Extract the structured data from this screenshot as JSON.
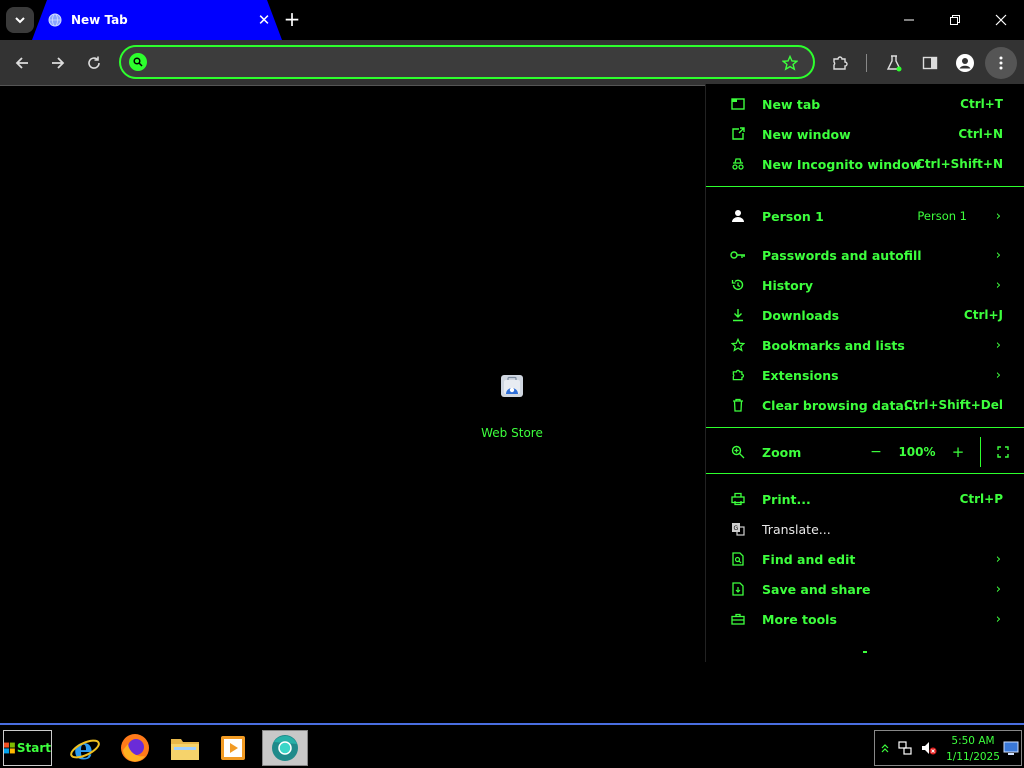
{
  "browser": {
    "tab": {
      "title": "New Tab",
      "close_glyph": "✕"
    },
    "new_tab_glyph": "+",
    "omnibox": {
      "value": "",
      "placeholder": ""
    }
  },
  "content": {
    "shortcuts": [
      {
        "label": "Web Store",
        "icon": "web-store-icon"
      }
    ]
  },
  "menu": {
    "group1": [
      {
        "label": "New tab",
        "shortcut": "Ctrl+T",
        "icon": "new-tab-icon"
      },
      {
        "label": "New window",
        "shortcut": "Ctrl+N",
        "icon": "new-window-icon"
      },
      {
        "label": "New Incognito window",
        "shortcut": "Ctrl+Shift+N",
        "icon": "incognito-icon"
      }
    ],
    "profile": {
      "label": "Person 1",
      "sub": "Person 1",
      "icon": "person-icon"
    },
    "group2": [
      {
        "label": "Passwords and autofill",
        "shortcut": "",
        "chevron": true,
        "icon": "key-icon"
      },
      {
        "label": "History",
        "shortcut": "",
        "chevron": true,
        "icon": "history-icon"
      },
      {
        "label": "Downloads",
        "shortcut": "Ctrl+J",
        "chevron": false,
        "icon": "download-icon"
      },
      {
        "label": "Bookmarks and lists",
        "shortcut": "",
        "chevron": true,
        "icon": "star-icon"
      },
      {
        "label": "Extensions",
        "shortcut": "",
        "chevron": true,
        "icon": "puzzle-icon"
      },
      {
        "label": "Clear browsing data...",
        "shortcut": "Ctrl+Shift+Del",
        "chevron": false,
        "icon": "trash-icon"
      }
    ],
    "zoom": {
      "label": "Zoom",
      "minus": "−",
      "level": "100%",
      "plus": "+"
    },
    "group3": [
      {
        "label": "Print...",
        "shortcut": "Ctrl+P",
        "chevron": false,
        "icon": "print-icon"
      },
      {
        "label": "Translate...",
        "shortcut": "",
        "chevron": false,
        "icon": "translate-icon"
      },
      {
        "label": "Find and edit",
        "shortcut": "",
        "chevron": true,
        "icon": "find-icon"
      },
      {
        "label": "Save and share",
        "shortcut": "",
        "chevron": true,
        "icon": "save-icon"
      },
      {
        "label": "More tools",
        "shortcut": "",
        "chevron": true,
        "icon": "toolbox-icon"
      }
    ],
    "chevron_glyph": "›"
  },
  "taskbar": {
    "start_label": "Start",
    "apps": [
      "internet-explorer-icon",
      "firefox-icon",
      "file-explorer-icon",
      "media-player-icon",
      "chrome-icon"
    ],
    "clock": {
      "time": "5:50 AM",
      "date": "1/11/2025"
    }
  },
  "colors": {
    "accent": "#3dff3d",
    "tab_bg": "#0000ff",
    "toolbar_bg": "#333333",
    "background": "#000000"
  }
}
